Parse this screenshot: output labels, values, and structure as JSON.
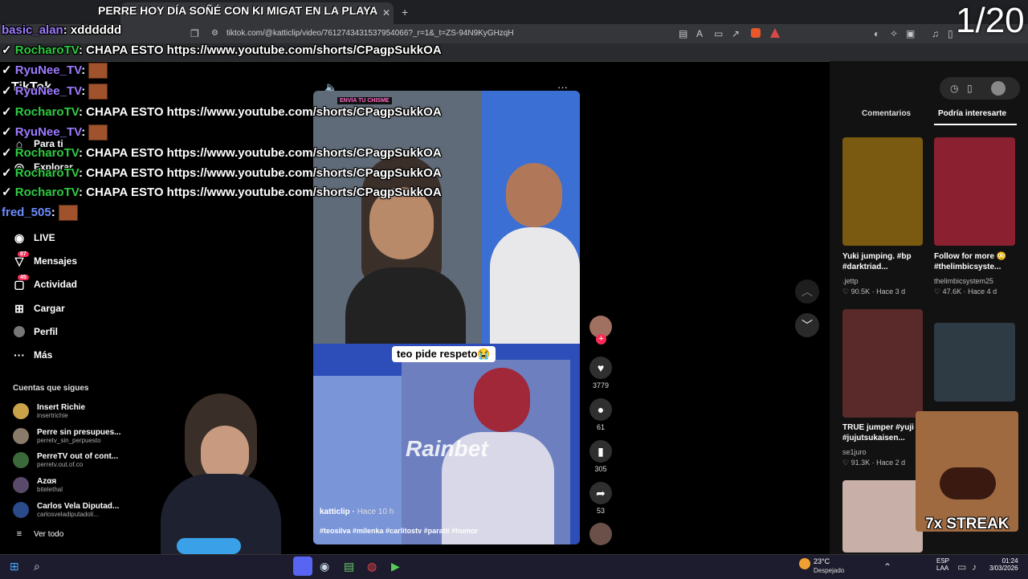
{
  "browser": {
    "tab_title": "PERRE HOY DÍA SOÑÉ CON KI MIGAT EN LA PLAYA",
    "url": "tiktok.com/@katticlip/video/7612743431537954066?_r=1&_t=ZS-94N9KyGHzqH"
  },
  "overlay": {
    "counter": "1/20",
    "streak": "7x STREAK"
  },
  "chat": [
    {
      "user": "basic_alan",
      "text": "xdddddd"
    },
    {
      "user": "RocharoTV",
      "text": "CHAPA ESTO https://www.youtube.com/shorts/CPagpSukkOA"
    },
    {
      "user": "RyuNee_TV",
      "text": ""
    },
    {
      "user": "RyuNee_TV",
      "text": ""
    },
    {
      "user": "RocharoTV",
      "text": "CHAPA ESTO https://www.youtube.com/shorts/CPagpSukkOA"
    },
    {
      "user": "RyuNee_TV",
      "text": ""
    },
    {
      "user": "RocharoTV",
      "text": "CHAPA ESTO https://www.youtube.com/shorts/CPagpSukkOA"
    },
    {
      "user": "RocharoTV",
      "text": "CHAPA ESTO https://www.youtube.com/shorts/CPagpSukkOA"
    },
    {
      "user": "RocharoTV",
      "text": "CHAPA ESTO https://www.youtube.com/shorts/CPagpSukkOA"
    },
    {
      "user": "fred_505",
      "text": ""
    }
  ],
  "sidebar": {
    "logo": "TikTok",
    "items": [
      {
        "label": "Para ti"
      },
      {
        "label": "Explorar"
      },
      {
        "label": "LIVE"
      },
      {
        "label": "Mensajes",
        "badge": "87"
      },
      {
        "label": "Actividad",
        "badge": "45"
      },
      {
        "label": "Cargar"
      },
      {
        "label": "Perfil"
      },
      {
        "label": "Más"
      }
    ],
    "following_title": "Cuentas que sigues",
    "following": [
      {
        "name": "Insert Richie",
        "user": "insertrichie"
      },
      {
        "name": "Perre sin presupues...",
        "user": "perretv_sin_perpuesto"
      },
      {
        "name": "PerreTV out of cont...",
        "user": "perretv.out.of.co"
      },
      {
        "name": "Azαя",
        "user": "bitelethal"
      },
      {
        "name": "Carlos Vela Diputad...",
        "user": "carlosveladiputadoli..."
      }
    ],
    "see_all": "Ver todo"
  },
  "video": {
    "caption_bubble": "teo pide respeto😭",
    "author": "katticlip",
    "time": "Hace 10 h",
    "hashtags": "#teosilva #milenka #carlitostv #paratii #humor",
    "watermark": "Rainbet",
    "top_label": "ENVÍA TU CHISME"
  },
  "actions": {
    "likes": "3779",
    "comments": "61",
    "saves": "305",
    "shares": "53"
  },
  "right": {
    "tabs": [
      "Comentarios",
      "Podría interesarte"
    ],
    "cards": [
      {
        "caption": "Yuki jumping. #bp #darktriad...",
        "author": ".jettp",
        "views": "90.5K",
        "age": "Hace 3 d"
      },
      {
        "caption": "Follow for more 😳 #thelimbicsyste...",
        "author": "thelimbicsystem25",
        "views": "47.6K",
        "age": "Hace 4 d"
      },
      {
        "caption": "TRUE jumper #yuji #jujutsukaisen...",
        "author": "se1juro",
        "views": "91.3K",
        "age": "Hace 2 d"
      }
    ]
  },
  "taskbar": {
    "weather_temp": "23°C",
    "weather_desc": "Despejado",
    "lang_1": "ESP",
    "lang_2": "LAA",
    "time": "01:24",
    "date": "3/03/2026"
  }
}
